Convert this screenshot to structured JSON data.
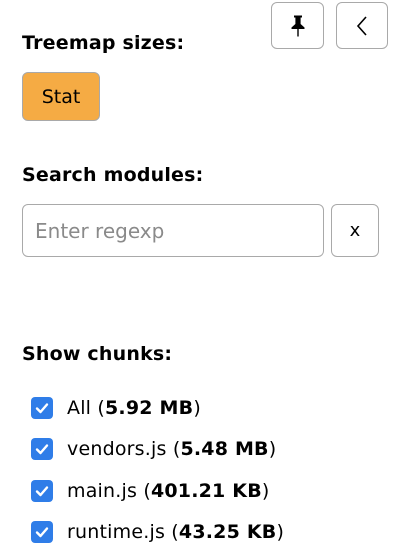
{
  "toolbar": {
    "pin_icon": "pin-icon",
    "collapse_icon": "chevron-left-icon"
  },
  "treemap_sizes": {
    "title": "Treemap sizes:",
    "active_option": "Stat",
    "active_color": "#f5ab44"
  },
  "search": {
    "title": "Search modules:",
    "placeholder": "Enter regexp",
    "value": "",
    "clear_label": "x"
  },
  "chunks": {
    "title": "Show chunks:",
    "checkbox_color": "#2f7de8",
    "items": [
      {
        "name": "All",
        "size": "5.92 MB",
        "checked": true
      },
      {
        "name": "vendors.js",
        "size": "5.48 MB",
        "checked": true
      },
      {
        "name": "main.js",
        "size": "401.21 KB",
        "checked": true
      },
      {
        "name": "runtime.js",
        "size": "43.25 KB",
        "checked": true
      }
    ]
  }
}
